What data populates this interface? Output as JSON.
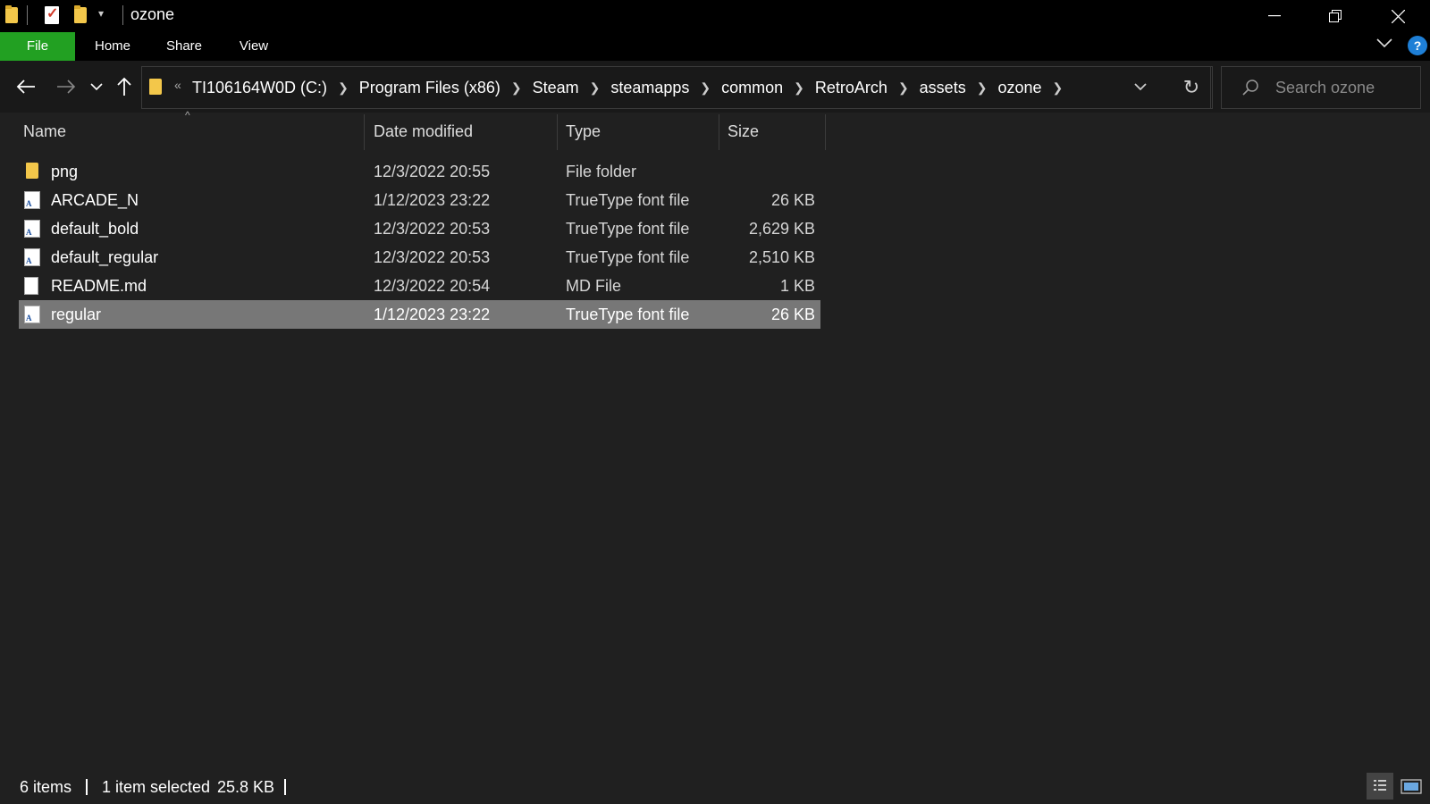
{
  "window": {
    "title": "ozone",
    "controls": [
      "minimize-icon",
      "restore-icon",
      "close-icon"
    ]
  },
  "ribbon": {
    "tabs": [
      {
        "label": "File",
        "active": true,
        "color": "#22a022"
      },
      {
        "label": "Home"
      },
      {
        "label": "Share"
      },
      {
        "label": "View"
      }
    ]
  },
  "navigation": {
    "breadcrumbs": [
      "TI106164W0D (C:)",
      "Program Files (x86)",
      "Steam",
      "steamapps",
      "common",
      "RetroArch",
      "assets",
      "ozone"
    ],
    "search_placeholder": "Search ozone"
  },
  "file_list": {
    "columns": [
      "Name",
      "Date modified",
      "Type",
      "Size"
    ],
    "sort_column": "Name",
    "rows": [
      {
        "name": "png",
        "date": "12/3/2022 20:55",
        "type": "File folder",
        "size": "",
        "icon": "folder-icon",
        "selected": false
      },
      {
        "name": "ARCADE_N",
        "date": "1/12/2023 23:22",
        "type": "TrueType font file",
        "size": "26 KB",
        "icon": "font-file-icon",
        "selected": false
      },
      {
        "name": "default_bold",
        "date": "12/3/2022 20:53",
        "type": "TrueType font file",
        "size": "2,629 KB",
        "icon": "font-file-icon",
        "selected": false
      },
      {
        "name": "default_regular",
        "date": "12/3/2022 20:53",
        "type": "TrueType font file",
        "size": "2,510 KB",
        "icon": "font-file-icon",
        "selected": false
      },
      {
        "name": "README.md",
        "date": "12/3/2022 20:54",
        "type": "MD File",
        "size": "1 KB",
        "icon": "document-icon",
        "selected": false
      },
      {
        "name": "regular",
        "date": "1/12/2023 23:22",
        "type": "TrueType font file",
        "size": "26 KB",
        "icon": "font-file-icon",
        "selected": true
      }
    ]
  },
  "status": {
    "item_count": "6 items",
    "selection": "1 item selected",
    "selection_size": "25.8 KB"
  },
  "colors": {
    "accent_file_tab": "#22a022",
    "selection": "#777777",
    "background": "#202020",
    "help": "#1e7fd6"
  }
}
